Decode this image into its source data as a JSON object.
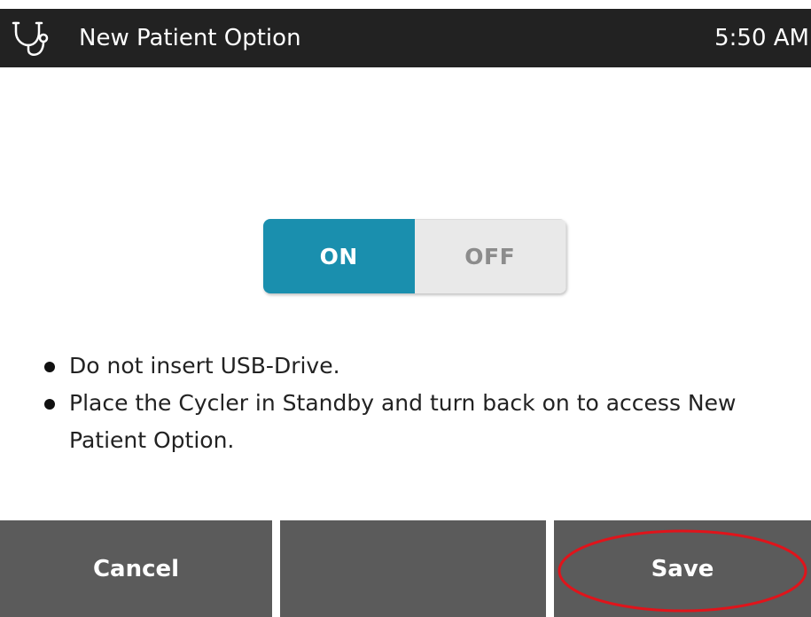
{
  "header": {
    "title": "New Patient Option",
    "time": "5:50 AM",
    "icon": "stethoscope-icon"
  },
  "toggle": {
    "on_label": "ON",
    "off_label": "OFF",
    "selected": "ON"
  },
  "notes": [
    "Do not insert USB-Drive.",
    "Place the Cycler in Standby and turn back on to access New Patient Option."
  ],
  "buttons": {
    "cancel_label": "Cancel",
    "middle_label": "",
    "save_label": "Save"
  },
  "colors": {
    "title_bar": "#222222",
    "toggle_on": "#1a8fae",
    "toggle_off": "#e9e9e9",
    "button": "#5b5b5b",
    "highlight": "#e0141b"
  }
}
